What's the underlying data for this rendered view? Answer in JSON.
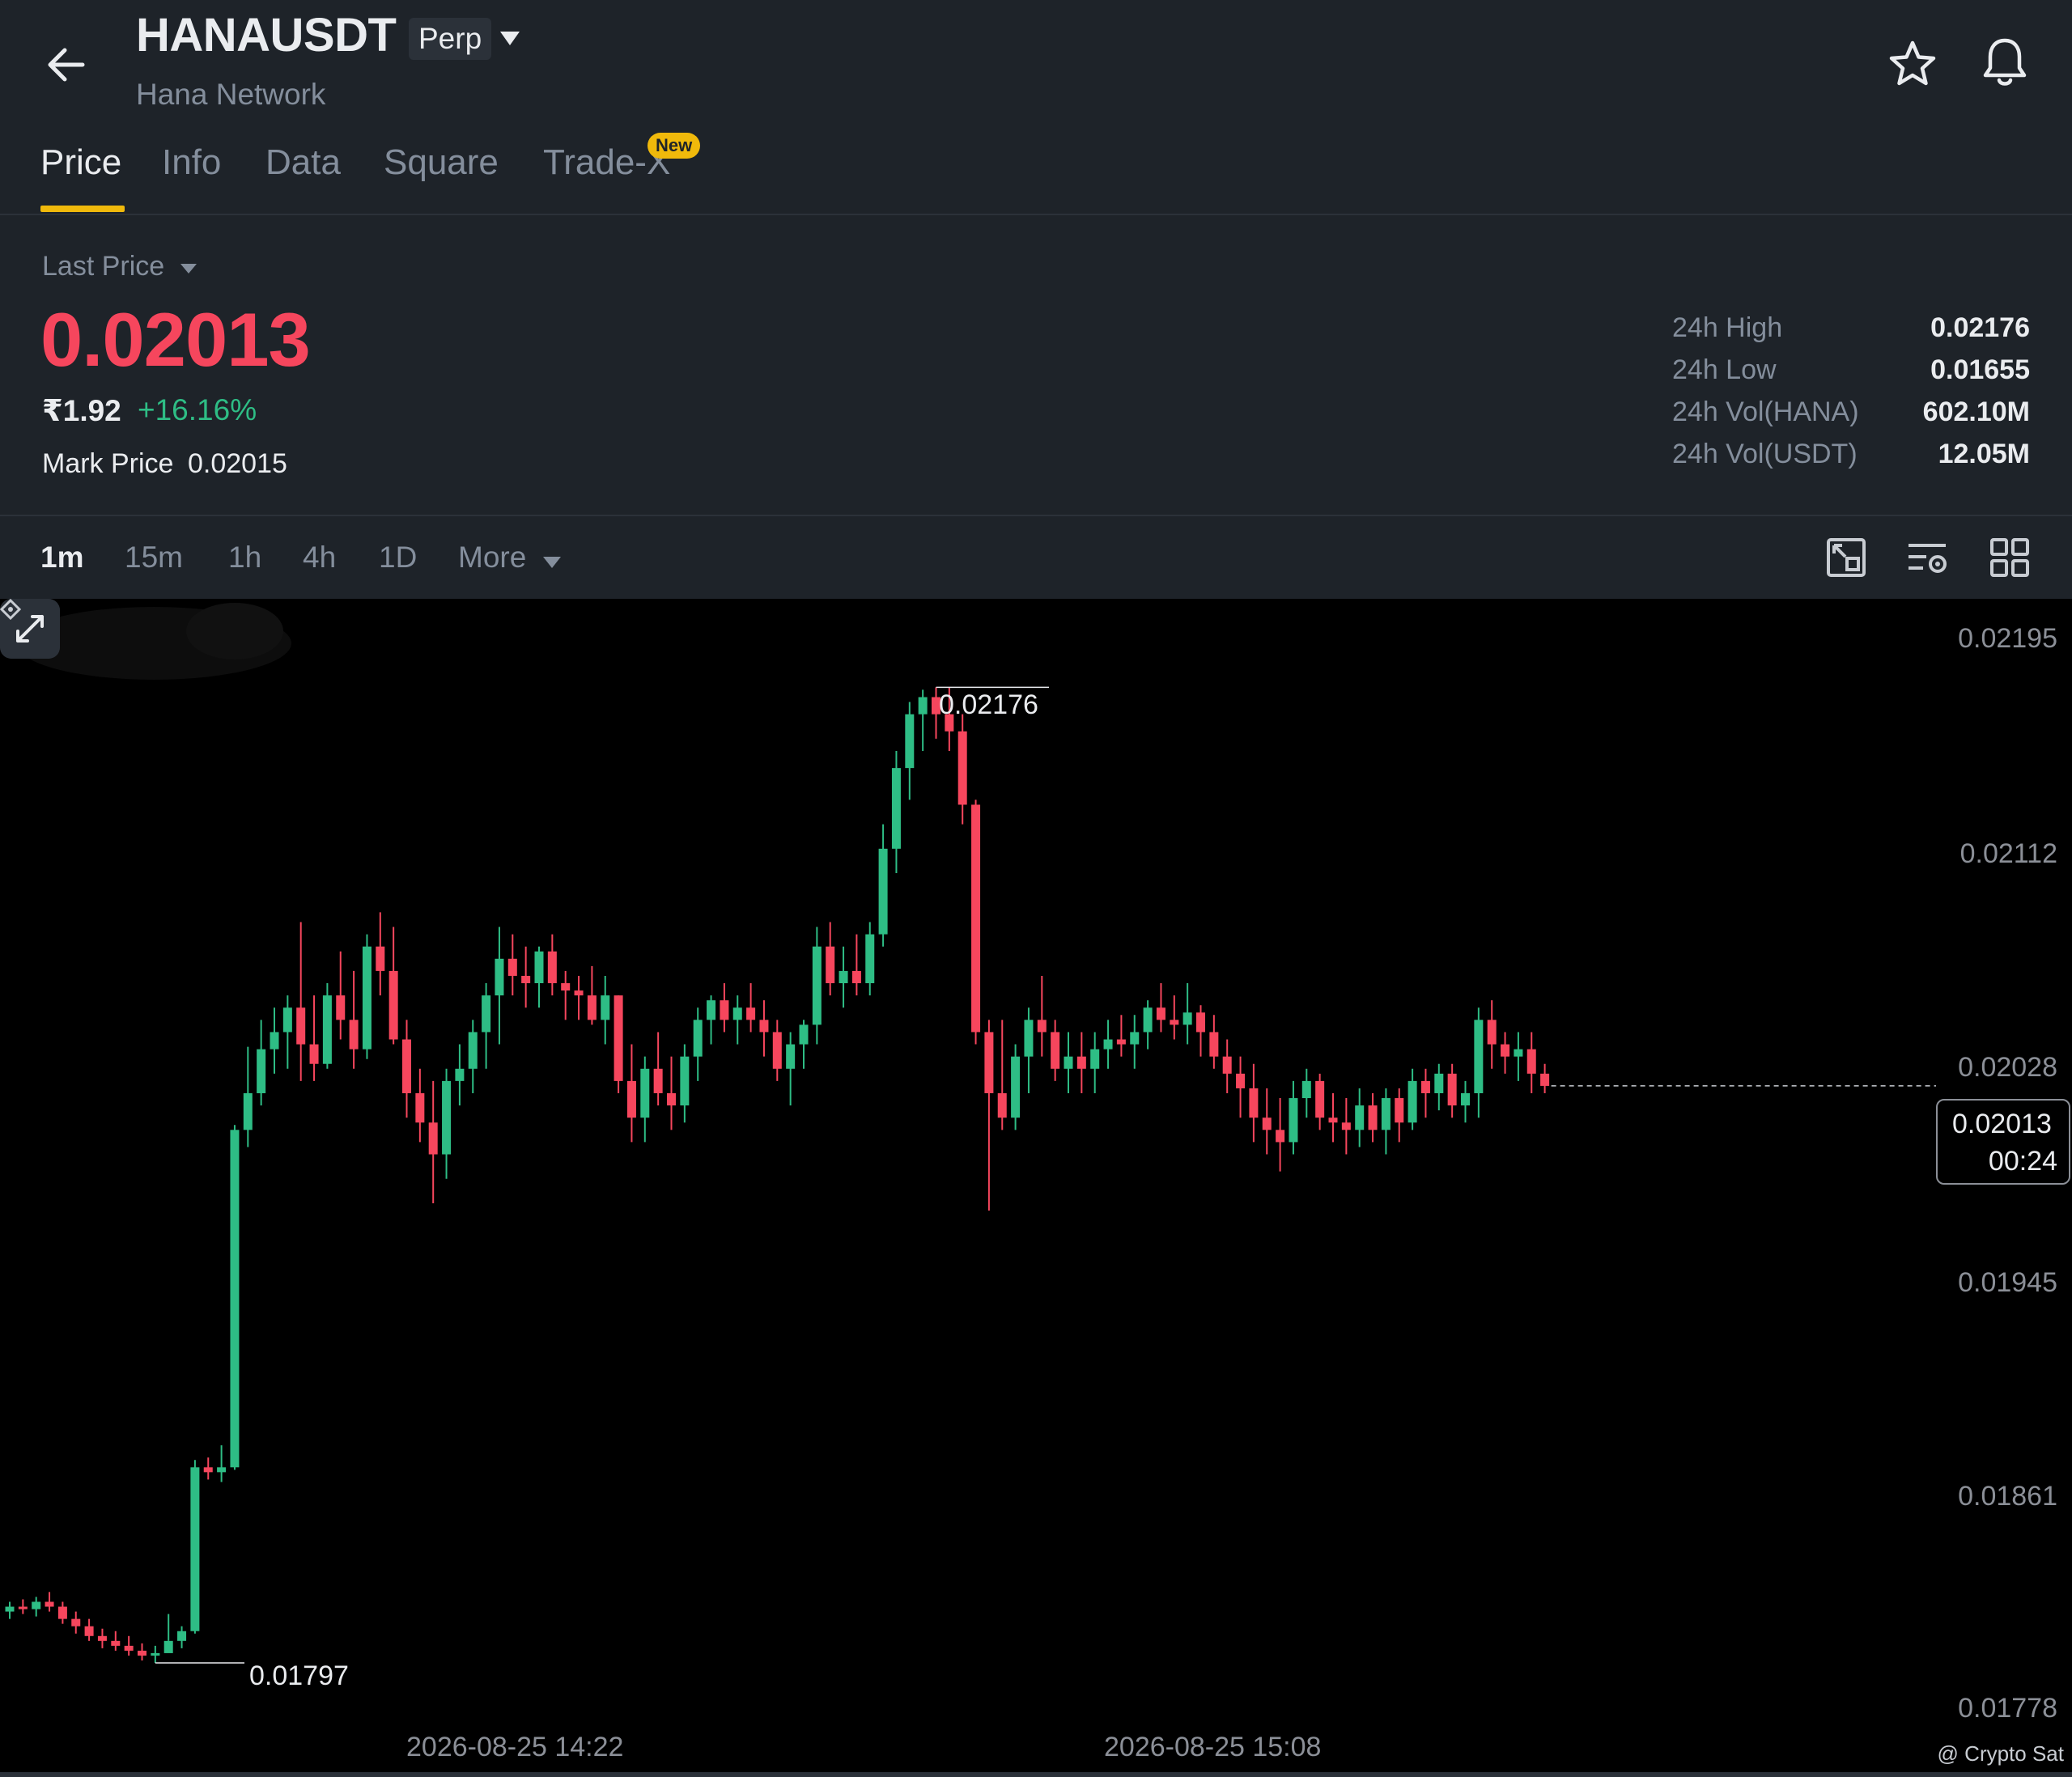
{
  "header": {
    "back_icon": "arrow-left-icon",
    "symbol": "HANAUSDT",
    "contract_badge": "Perp",
    "network": "Hana Network",
    "favorite_icon": "star-icon",
    "alert_icon": "bell-icon"
  },
  "tabs": [
    {
      "label": "Price",
      "active": true
    },
    {
      "label": "Info",
      "active": false
    },
    {
      "label": "Data",
      "active": false
    },
    {
      "label": "Square",
      "active": false
    },
    {
      "label": "Trade-X",
      "active": false,
      "badge": "New"
    }
  ],
  "price": {
    "selector_label": "Last Price",
    "last": "0.02013",
    "fiat": "₹1.92",
    "change_pct": "+16.16%",
    "mark_label": "Mark Price",
    "mark_value": "0.02015"
  },
  "stats": [
    {
      "label": "24h High",
      "value": "0.02176"
    },
    {
      "label": "24h Low",
      "value": "0.01655"
    },
    {
      "label": "24h Vol(HANA)",
      "value": "602.10M"
    },
    {
      "label": "24h Vol(USDT)",
      "value": "12.05M"
    }
  ],
  "intervals": {
    "items": [
      "1m",
      "15m",
      "1h",
      "4h",
      "1D"
    ],
    "active": "1m",
    "more_label": "More",
    "tool_icons": [
      "fullscreen-chart-icon",
      "indicator-settings-icon",
      "grid-layout-icon"
    ]
  },
  "colors": {
    "up": "#2ebd85",
    "down": "#f6465d",
    "accent": "#f0b90b",
    "panel": "#1e2329",
    "chart_bg": "#000000"
  },
  "chart_data": {
    "type": "candlestick",
    "y_ticks": [
      "0.02195",
      "0.02112",
      "0.02028",
      "0.01945",
      "0.01861",
      "0.01778"
    ],
    "ylim": [
      0.01778,
      0.02195
    ],
    "x_ticks": [
      "2026-08-25 14:22",
      "2026-08-25 15:08"
    ],
    "high_marker": "0.02176",
    "low_marker": "0.01797",
    "current_price": "0.02013",
    "countdown": "00:24",
    "expand_icon": "expand-arrows-icon",
    "credit": "@ Crypto Sat",
    "credit_icon": "crypto-sat-logo-icon",
    "candles": [
      [
        0.01798,
        0.01802,
        0.01795,
        0.018
      ],
      [
        0.018,
        0.01803,
        0.01797,
        0.01799
      ],
      [
        0.01799,
        0.01804,
        0.01796,
        0.01802
      ],
      [
        0.01802,
        0.01806,
        0.01798,
        0.018
      ],
      [
        0.018,
        0.01802,
        0.01793,
        0.01795
      ],
      [
        0.01795,
        0.01798,
        0.01789,
        0.01792
      ],
      [
        0.01792,
        0.01795,
        0.01786,
        0.01788
      ],
      [
        0.01788,
        0.01791,
        0.01783,
        0.01786
      ],
      [
        0.01786,
        0.0179,
        0.01782,
        0.01784
      ],
      [
        0.01784,
        0.01788,
        0.0178,
        0.01782
      ],
      [
        0.01782,
        0.01785,
        0.01778,
        0.0178
      ],
      [
        0.0178,
        0.01784,
        0.01777,
        0.01781
      ],
      [
        0.01781,
        0.01786,
        0.01797,
        0.01786
      ],
      [
        0.01786,
        0.01792,
        0.01783,
        0.0179
      ],
      [
        0.0179,
        0.0186,
        0.01789,
        0.01857
      ],
      [
        0.01857,
        0.01861,
        0.01852,
        0.01855
      ],
      [
        0.01855,
        0.01866,
        0.01851,
        0.01857
      ],
      [
        0.01857,
        0.01997,
        0.01856,
        0.01995
      ],
      [
        0.01995,
        0.02029,
        0.01988,
        0.0201
      ],
      [
        0.0201,
        0.0204,
        0.02005,
        0.02028
      ],
      [
        0.02028,
        0.02045,
        0.02018,
        0.02035
      ],
      [
        0.02035,
        0.0205,
        0.0202,
        0.02045
      ],
      [
        0.02045,
        0.0208,
        0.02015,
        0.0203
      ],
      [
        0.0203,
        0.0205,
        0.02015,
        0.02022
      ],
      [
        0.02022,
        0.02055,
        0.0202,
        0.0205
      ],
      [
        0.0205,
        0.02068,
        0.02032,
        0.0204
      ],
      [
        0.0204,
        0.0206,
        0.0202,
        0.02028
      ],
      [
        0.02028,
        0.02075,
        0.02024,
        0.0207
      ],
      [
        0.0207,
        0.02084,
        0.0205,
        0.0206
      ],
      [
        0.0206,
        0.02078,
        0.0203,
        0.02032
      ],
      [
        0.02032,
        0.0204,
        0.02,
        0.0201
      ],
      [
        0.0201,
        0.0202,
        0.0199,
        0.01998
      ],
      [
        0.01998,
        0.02015,
        0.01965,
        0.01985
      ],
      [
        0.01985,
        0.0202,
        0.01975,
        0.02015
      ],
      [
        0.02015,
        0.0203,
        0.02005,
        0.0202
      ],
      [
        0.0202,
        0.0204,
        0.0201,
        0.02035
      ],
      [
        0.02035,
        0.02055,
        0.0202,
        0.0205
      ],
      [
        0.0205,
        0.02078,
        0.0203,
        0.02065
      ],
      [
        0.02065,
        0.02075,
        0.0205,
        0.02058
      ],
      [
        0.02058,
        0.0207,
        0.02045,
        0.02055
      ],
      [
        0.02055,
        0.0207,
        0.02045,
        0.02068
      ],
      [
        0.02068,
        0.02075,
        0.0205,
        0.02055
      ],
      [
        0.02055,
        0.0206,
        0.0204,
        0.02052
      ],
      [
        0.02052,
        0.02058,
        0.0204,
        0.0205
      ],
      [
        0.0205,
        0.02062,
        0.02038,
        0.0204
      ],
      [
        0.0204,
        0.02058,
        0.0203,
        0.0205
      ],
      [
        0.0205,
        0.0205,
        0.0201,
        0.02015
      ],
      [
        0.02015,
        0.0203,
        0.0199,
        0.02
      ],
      [
        0.02,
        0.02025,
        0.0199,
        0.0202
      ],
      [
        0.0202,
        0.02035,
        0.02005,
        0.0201
      ],
      [
        0.0201,
        0.02025,
        0.01995,
        0.02005
      ],
      [
        0.02005,
        0.0203,
        0.01998,
        0.02025
      ],
      [
        0.02025,
        0.02045,
        0.02015,
        0.0204
      ],
      [
        0.0204,
        0.0205,
        0.0203,
        0.02048
      ],
      [
        0.02048,
        0.02055,
        0.02035,
        0.0204
      ],
      [
        0.0204,
        0.0205,
        0.0203,
        0.02045
      ],
      [
        0.02045,
        0.02055,
        0.02035,
        0.0204
      ],
      [
        0.0204,
        0.02048,
        0.02025,
        0.02035
      ],
      [
        0.02035,
        0.0204,
        0.02015,
        0.0202
      ],
      [
        0.0202,
        0.02035,
        0.02005,
        0.0203
      ],
      [
        0.0203,
        0.0204,
        0.0202,
        0.02038
      ],
      [
        0.02038,
        0.02078,
        0.0203,
        0.0207
      ],
      [
        0.0207,
        0.0208,
        0.0205,
        0.02055
      ],
      [
        0.02055,
        0.0207,
        0.02045,
        0.0206
      ],
      [
        0.0206,
        0.02075,
        0.0205,
        0.02055
      ],
      [
        0.02055,
        0.0208,
        0.0205,
        0.02075
      ],
      [
        0.02075,
        0.0212,
        0.0207,
        0.0211
      ],
      [
        0.0211,
        0.0215,
        0.021,
        0.02143
      ],
      [
        0.02143,
        0.0217,
        0.0213,
        0.02165
      ],
      [
        0.02165,
        0.02175,
        0.0215,
        0.02172
      ],
      [
        0.02172,
        0.02176,
        0.02155,
        0.02165
      ],
      [
        0.02165,
        0.02176,
        0.0215,
        0.02158
      ],
      [
        0.02158,
        0.02165,
        0.0212,
        0.02128
      ],
      [
        0.02128,
        0.0213,
        0.0203,
        0.02035
      ],
      [
        0.02035,
        0.0204,
        0.01962,
        0.0201
      ],
      [
        0.0201,
        0.0204,
        0.01995,
        0.02
      ],
      [
        0.02,
        0.0203,
        0.01995,
        0.02025
      ],
      [
        0.02025,
        0.02045,
        0.0201,
        0.0204
      ],
      [
        0.0204,
        0.02058,
        0.02025,
        0.02035
      ],
      [
        0.02035,
        0.0204,
        0.02015,
        0.0202
      ],
      [
        0.0202,
        0.02035,
        0.0201,
        0.02025
      ],
      [
        0.02025,
        0.02035,
        0.0201,
        0.0202
      ],
      [
        0.0202,
        0.02035,
        0.0201,
        0.02028
      ],
      [
        0.02028,
        0.0204,
        0.0202,
        0.02032
      ],
      [
        0.02032,
        0.02042,
        0.02025,
        0.0203
      ],
      [
        0.0203,
        0.02042,
        0.0202,
        0.02035
      ],
      [
        0.02035,
        0.02048,
        0.02028,
        0.02045
      ],
      [
        0.02045,
        0.02055,
        0.02035,
        0.0204
      ],
      [
        0.0204,
        0.0205,
        0.02032,
        0.02038
      ],
      [
        0.02038,
        0.02055,
        0.0203,
        0.02043
      ],
      [
        0.02043,
        0.02046,
        0.02025,
        0.02035
      ],
      [
        0.02035,
        0.02042,
        0.0202,
        0.02025
      ],
      [
        0.02025,
        0.02032,
        0.0201,
        0.02018
      ],
      [
        0.02018,
        0.02025,
        0.02,
        0.02012
      ],
      [
        0.02012,
        0.02022,
        0.0199,
        0.02
      ],
      [
        0.02,
        0.02012,
        0.01985,
        0.01995
      ],
      [
        0.01995,
        0.02008,
        0.01978,
        0.0199
      ],
      [
        0.0199,
        0.02015,
        0.01985,
        0.02008
      ],
      [
        0.02008,
        0.0202,
        0.02,
        0.02015
      ],
      [
        0.02015,
        0.02018,
        0.01995,
        0.02
      ],
      [
        0.02,
        0.0201,
        0.0199,
        0.01998
      ],
      [
        0.01998,
        0.02008,
        0.01985,
        0.01995
      ],
      [
        0.01995,
        0.02012,
        0.01988,
        0.02005
      ],
      [
        0.02005,
        0.0201,
        0.0199,
        0.01995
      ],
      [
        0.01995,
        0.02012,
        0.01985,
        0.02008
      ],
      [
        0.02008,
        0.02012,
        0.0199,
        0.01998
      ],
      [
        0.01998,
        0.0202,
        0.01995,
        0.02015
      ],
      [
        0.02015,
        0.0202,
        0.02,
        0.0201
      ],
      [
        0.0201,
        0.02022,
        0.02003,
        0.02018
      ],
      [
        0.02018,
        0.02022,
        0.02,
        0.02005
      ],
      [
        0.02005,
        0.02015,
        0.01998,
        0.0201
      ],
      [
        0.0201,
        0.02045,
        0.02,
        0.0204
      ],
      [
        0.0204,
        0.02048,
        0.0202,
        0.0203
      ],
      [
        0.0203,
        0.02035,
        0.02018,
        0.02025
      ],
      [
        0.02025,
        0.02035,
        0.02015,
        0.02028
      ],
      [
        0.02028,
        0.02035,
        0.0201,
        0.02018
      ],
      [
        0.02018,
        0.02022,
        0.0201,
        0.02013
      ]
    ]
  }
}
